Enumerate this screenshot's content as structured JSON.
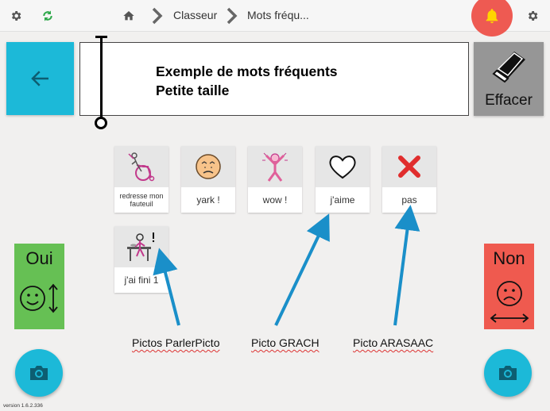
{
  "topbar": {
    "settings_icon": "gear-icon",
    "sync_icon": "sync-icon",
    "home_icon": "home-icon",
    "breadcrumb": [
      "Classeur",
      "Mots fréqu..."
    ],
    "bell_icon": "bell-icon",
    "right_settings_icon": "gear-icon"
  },
  "message": {
    "line1": "Exemple de mots fréquents",
    "line2": "Petite taille"
  },
  "effacer_label": "Effacer",
  "tiles": [
    {
      "label": "redresse mon fauteuil",
      "icon": "wheelchair-icon"
    },
    {
      "label": "yark !",
      "icon": "disgust-face-icon"
    },
    {
      "label": "wow !",
      "icon": "wow-person-icon"
    },
    {
      "label": "j'aime",
      "icon": "heart-icon"
    },
    {
      "label": "pas",
      "icon": "red-cross-icon"
    },
    {
      "label": "j'ai fini 1",
      "icon": "finished-eating-icon"
    }
  ],
  "oui_label": "Oui",
  "non_label": "Non",
  "annotations": [
    "Pictos ParlerPicto",
    "Picto GRACH",
    "Picto ARASAAC"
  ],
  "version": "version 1.6.2.336",
  "colors": {
    "accent_blue": "#1cb9d8",
    "yes_green": "#66c054",
    "no_red": "#ef5a4f",
    "bell_red": "#ee5a52",
    "arrow_blue": "#1a8fc9"
  }
}
